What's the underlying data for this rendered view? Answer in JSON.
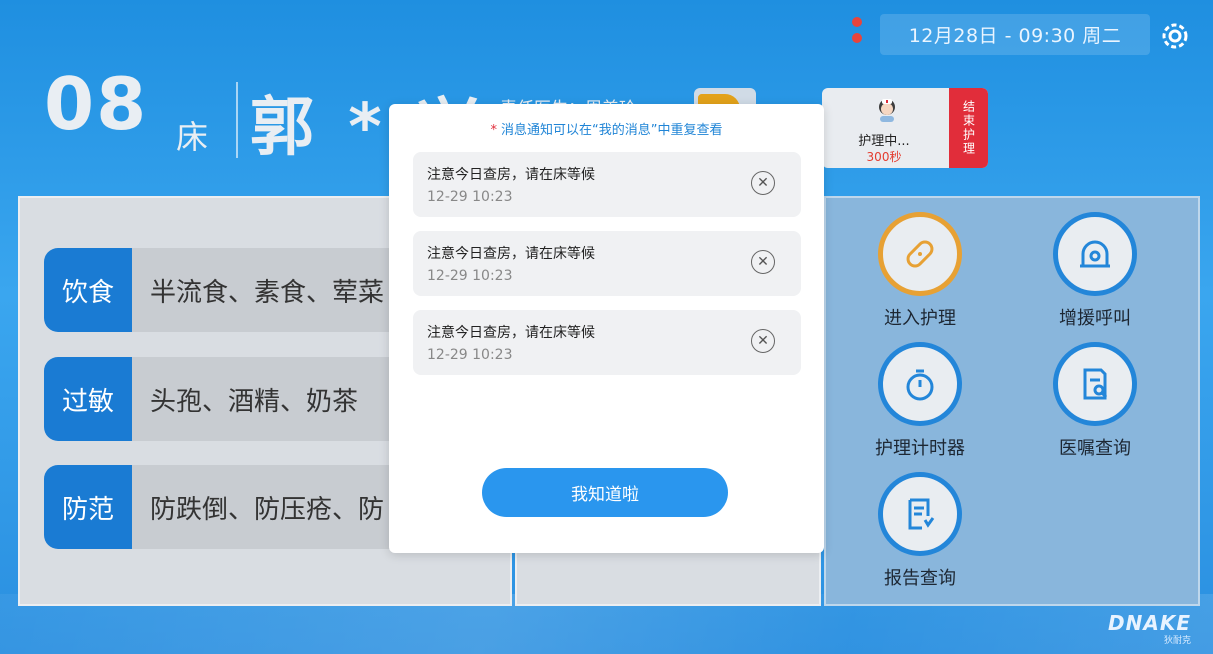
{
  "status_bar": {
    "datetime": "12月28日 - 09:30  周二",
    "icons": [
      "signal-alert-icon",
      "network-alert-icon",
      "gear-icon"
    ]
  },
  "header": {
    "bed_number": "08",
    "bed_unit": "床",
    "patient_name": "郭 * 兴",
    "doctor_label": "责任医生：周美玲"
  },
  "nurse_card": {
    "status": "护理中...",
    "time": "300秒",
    "end_button": "结束护理"
  },
  "info_rows": [
    {
      "tag": "饮食",
      "value": "半流食、素食、荤菜"
    },
    {
      "tag": "过敏",
      "value": "头孢、酒精、奶茶"
    },
    {
      "tag": "防范",
      "value": "防跌倒、防压疮、防"
    }
  ],
  "actions": [
    {
      "label": "进入护理",
      "icon": "bandage-icon",
      "accent": "#e7a134"
    },
    {
      "label": "增援呼叫",
      "icon": "alarm-light-icon",
      "accent": "#2386d9"
    },
    {
      "label": "护理计时器",
      "icon": "stopwatch-icon",
      "accent": "#2386d9"
    },
    {
      "label": "医嘱查询",
      "icon": "document-search-icon",
      "accent": "#2386d9"
    },
    {
      "label": "报告查询",
      "icon": "report-icon",
      "accent": "#2386d9"
    }
  ],
  "modal": {
    "hint": "消息通知可以在“我的消息”中重复查看",
    "messages": [
      {
        "title": "注意今日查房，请在床等候",
        "time": "12-29  10:23"
      },
      {
        "title": "注意今日查房，请在床等候",
        "time": "12-29  10:23"
      },
      {
        "title": "注意今日查房，请在床等候",
        "time": "12-29  10:23"
      }
    ],
    "ok_button": "我知道啦"
  },
  "logo": {
    "brand": "DNAKE",
    "sub": "狄耐克"
  },
  "colors": {
    "primary": "#1a7bd3",
    "accent_red": "#e12d3a",
    "accent_orange": "#e7a134",
    "button_blue": "#2a96ee"
  }
}
